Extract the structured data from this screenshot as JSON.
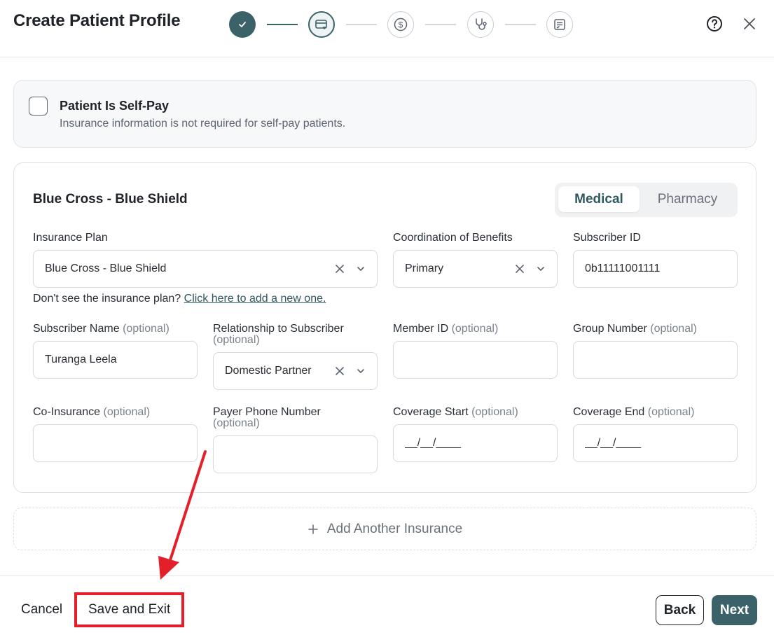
{
  "header": {
    "title": "Create Patient Profile",
    "help_icon": "question-circle-icon",
    "close_icon": "close-icon"
  },
  "stepper": {
    "steps": [
      {
        "state": "complete",
        "icon": "check-icon"
      },
      {
        "state": "active",
        "icon": "insurance-card-icon"
      },
      {
        "state": "pending",
        "icon": "dollar-icon"
      },
      {
        "state": "pending",
        "icon": "stethoscope-icon"
      },
      {
        "state": "pending",
        "icon": "clipboard-list-icon"
      }
    ]
  },
  "self_pay": {
    "checked": false,
    "title": "Patient Is Self-Pay",
    "subtitle": "Insurance information is not required for self-pay patients."
  },
  "insurance": {
    "name": "Blue Cross - Blue Shield",
    "tabs": {
      "medical": "Medical",
      "pharmacy": "Pharmacy",
      "selected": "Medical"
    },
    "plan": {
      "label": "Insurance Plan",
      "value": "Blue Cross - Blue Shield"
    },
    "cob": {
      "label": "Coordination of Benefits",
      "value": "Primary"
    },
    "subscriber_id": {
      "label": "Subscriber ID",
      "value": "0b11111001111"
    },
    "helper": {
      "text": "Don't see the insurance plan? ",
      "link": "Click here to add a new one."
    },
    "optional_text": "(optional)",
    "subscriber_name": {
      "label": "Subscriber Name",
      "value": "Turanga Leela"
    },
    "relationship": {
      "label": "Relationship to Subscriber",
      "value": "Domestic Partner"
    },
    "member_id": {
      "label": "Member ID",
      "value": ""
    },
    "group_number": {
      "label": "Group Number",
      "value": ""
    },
    "co_insurance": {
      "label": "Co-Insurance",
      "value": ""
    },
    "payer_phone": {
      "label": "Payer Phone Number",
      "value": ""
    },
    "coverage_start": {
      "label": "Coverage Start",
      "placeholder": "__/__/____"
    },
    "coverage_end": {
      "label": "Coverage End",
      "placeholder": "__/__/____"
    }
  },
  "add_another": {
    "label": "Add Another Insurance"
  },
  "footer": {
    "cancel": "Cancel",
    "save_exit": "Save and Exit",
    "back": "Back",
    "next": "Next"
  },
  "colors": {
    "accent": "#3b6169",
    "annotation": "#e3202a"
  }
}
